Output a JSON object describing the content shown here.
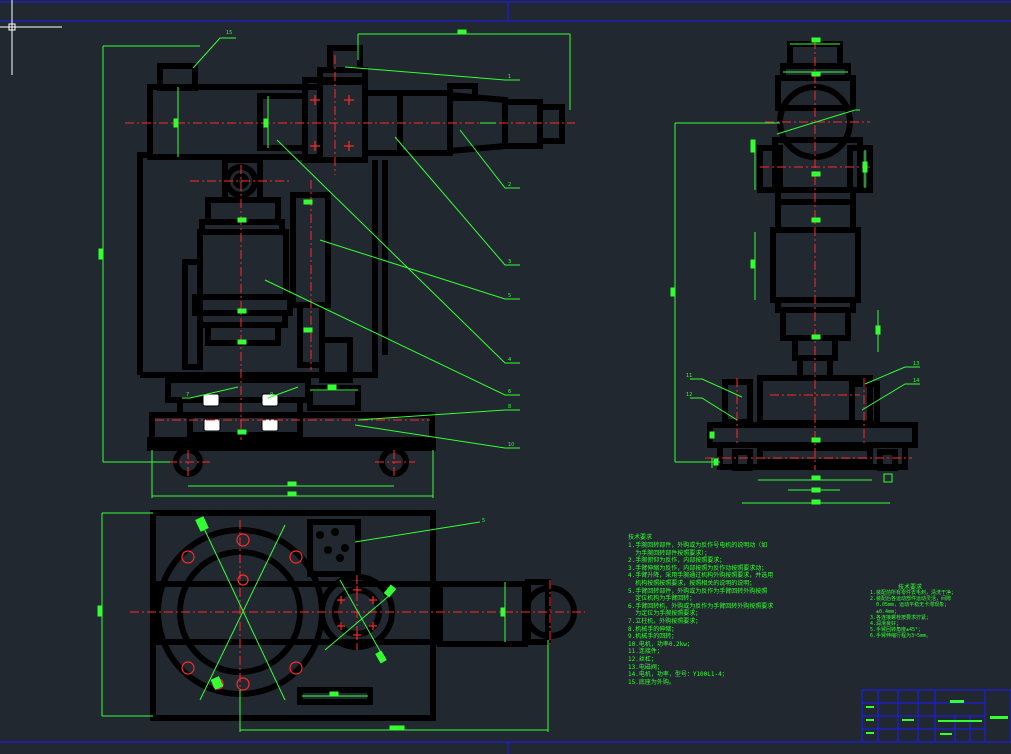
{
  "colors": {
    "background": "#212830",
    "outline": "#000000",
    "leader": "#33ff33",
    "centerline": "#ff2a2a",
    "frame": "#1a1aff"
  },
  "balloons": [
    "1",
    "2",
    "3",
    "5",
    "4",
    "6",
    "8",
    "10",
    "7",
    "9",
    "11",
    "12",
    "13",
    "14",
    "5"
  ],
  "top_mark": "15",
  "notes": {
    "heading": "技术要求",
    "lines": [
      "1.手腕回转部件，外购或为反作号电机的说明动（如",
      "  为手腕回转部件按照要求）；",
      "2.手腕俯仰为反作，内部按照要求；",
      "3.手臂伸缩为反作，内部按照为反作动按照要求动；",
      "4.手臂升降，采用手腕通过机构外购按照要求，并选用",
      "  机构按照按照要求，按照相关的说明的说明；",
      "5.手臂回转部件，外购或为反作为手臂回转外购按照",
      "  定位机构为手臂回转；",
      "6.手臂回转机，外购或为反作为手臂回转外购按照要求",
      "  为定位为手腕按照要求；",
      "7.立柱机，外购按照要求；",
      "8.机械手的伸缩；",
      "9.机械手的回转；",
      "10.电机，功率0.2kw；",
      "11.连接件；",
      "12.丝杠；",
      "13.电磁阀；",
      "14.电机，功率，型号：Y100L1-4；",
      "15.底座为外购。"
    ]
  },
  "tech": {
    "heading": "技术要求",
    "lines": [
      "1.装配前所有零件去毛刺，清洗干净；",
      "2.装配后各运动部件运动灵活，间隙",
      "  0.05mm，运动平稳无卡滞现象；",
      "  ±0.4mm；",
      "3.各连接螺栓按要求拧紧；",
      "4.润滑良好；",
      "5.手臂回转角度±45°；",
      "6.手臂伸缩行程为3~5mm。"
    ]
  }
}
